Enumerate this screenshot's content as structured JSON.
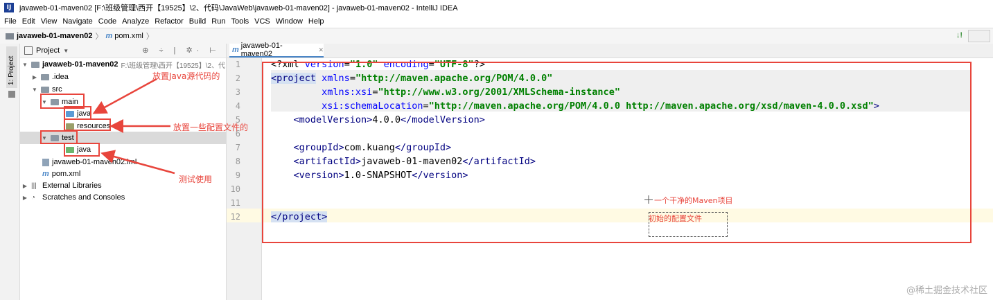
{
  "window": {
    "title": "javaweb-01-maven02 [F:\\班级管理\\西开【19525】\\2、代码\\JavaWeb\\javaweb-01-maven02] - javaweb-01-maven02 - IntelliJ IDEA",
    "logo": "IJ"
  },
  "menu": [
    "File",
    "Edit",
    "View",
    "Navigate",
    "Code",
    "Analyze",
    "Refactor",
    "Build",
    "Run",
    "Tools",
    "VCS",
    "Window",
    "Help"
  ],
  "breadcrumb": {
    "project": "javaweb-01-maven02",
    "file_prefix": "m",
    "file": "pom.xml",
    "separator": "〉"
  },
  "navbar": {
    "right_icon": "↓!"
  },
  "sidebar_tab": "1: Project",
  "project_panel": {
    "label": "Project",
    "caret": "▼",
    "tools": "⊕ ÷ | ✲· ⊢",
    "tree": [
      {
        "label": "javaweb-01-maven02",
        "path": "F:\\班级管理\\西开【19525】\\2、代",
        "arrow": "▼"
      },
      {
        "label": ".idea",
        "arrow": "▶"
      },
      {
        "label": "src",
        "arrow": "▼"
      },
      {
        "label": "main",
        "arrow": "▼"
      },
      {
        "label": "java"
      },
      {
        "label": "resources"
      },
      {
        "label": "test",
        "arrow": "▼"
      },
      {
        "label": "java"
      },
      {
        "label": "javaweb-01-maven02.iml"
      },
      {
        "label": "pom.xml",
        "prefix": "m"
      },
      {
        "label": "External Libraries",
        "arrow": "▶",
        "icon": "|||"
      },
      {
        "label": "Scratches and Consoles",
        "arrow": "▶",
        "icon": "◔"
      }
    ]
  },
  "editor": {
    "tab": {
      "prefix": "m",
      "label": "javaweb-01-maven02",
      "close": "✕"
    },
    "line_numbers": [
      "1",
      "2",
      "3",
      "4",
      "5",
      "6",
      "7",
      "8",
      "9",
      "10",
      "11",
      "12"
    ],
    "lines": {
      "l1": {
        "a": "<?xml ",
        "b": "version",
        "c": "=",
        "d": "\"1.0\"",
        "e": " ",
        "f": "encoding",
        "g": "=",
        "h": "\"UTF-8\"",
        "i": "?>"
      },
      "l2": {
        "a": "<project",
        "b": " xmlns",
        "c": "=",
        "d": "\"http://maven.apache.org/POM/4.0.0\""
      },
      "l3": {
        "indent": "         ",
        "b": "xmlns:xsi",
        "c": "=",
        "d": "\"http://www.w3.org/2001/XMLSchema-instance\""
      },
      "l4": {
        "indent": "         ",
        "b": "xsi:schemaLocation",
        "c": "=",
        "d": "\"http://maven.apache.org/POM/4.0.0 http://maven.apache.org/xsd/maven-4.0.0.xsd\"",
        "e": ">"
      },
      "l5": {
        "indent": "    ",
        "a": "<modelVersion>",
        "t": "4.0.0",
        "z": "</modelVersion>"
      },
      "l7": {
        "indent": "    ",
        "a": "<groupId>",
        "t": "com.kuang",
        "z": "</groupId>"
      },
      "l8": {
        "indent": "    ",
        "a": "<artifactId>",
        "t": "javaweb-01-maven02",
        "z": "</artifactId>"
      },
      "l9": {
        "indent": "    ",
        "a": "<version>",
        "t": "1.0-SNAPSHOT",
        "z": "</version>"
      },
      "l12": {
        "a": "</project>"
      }
    }
  },
  "annotations": {
    "java_source": "放置Java源代码的",
    "config_files": "放置一些配置文件的",
    "test_use": "测试使用",
    "clean_maven": "一个干净的Maven项目",
    "initial_config": "初始的配置文件"
  },
  "watermark": "@稀土掘金技术社区",
  "colors": {
    "annotation": "#e8453c",
    "tag": "#000080",
    "attr": "#0000ff",
    "value": "#008000",
    "line_highlight": "#fffae3"
  }
}
